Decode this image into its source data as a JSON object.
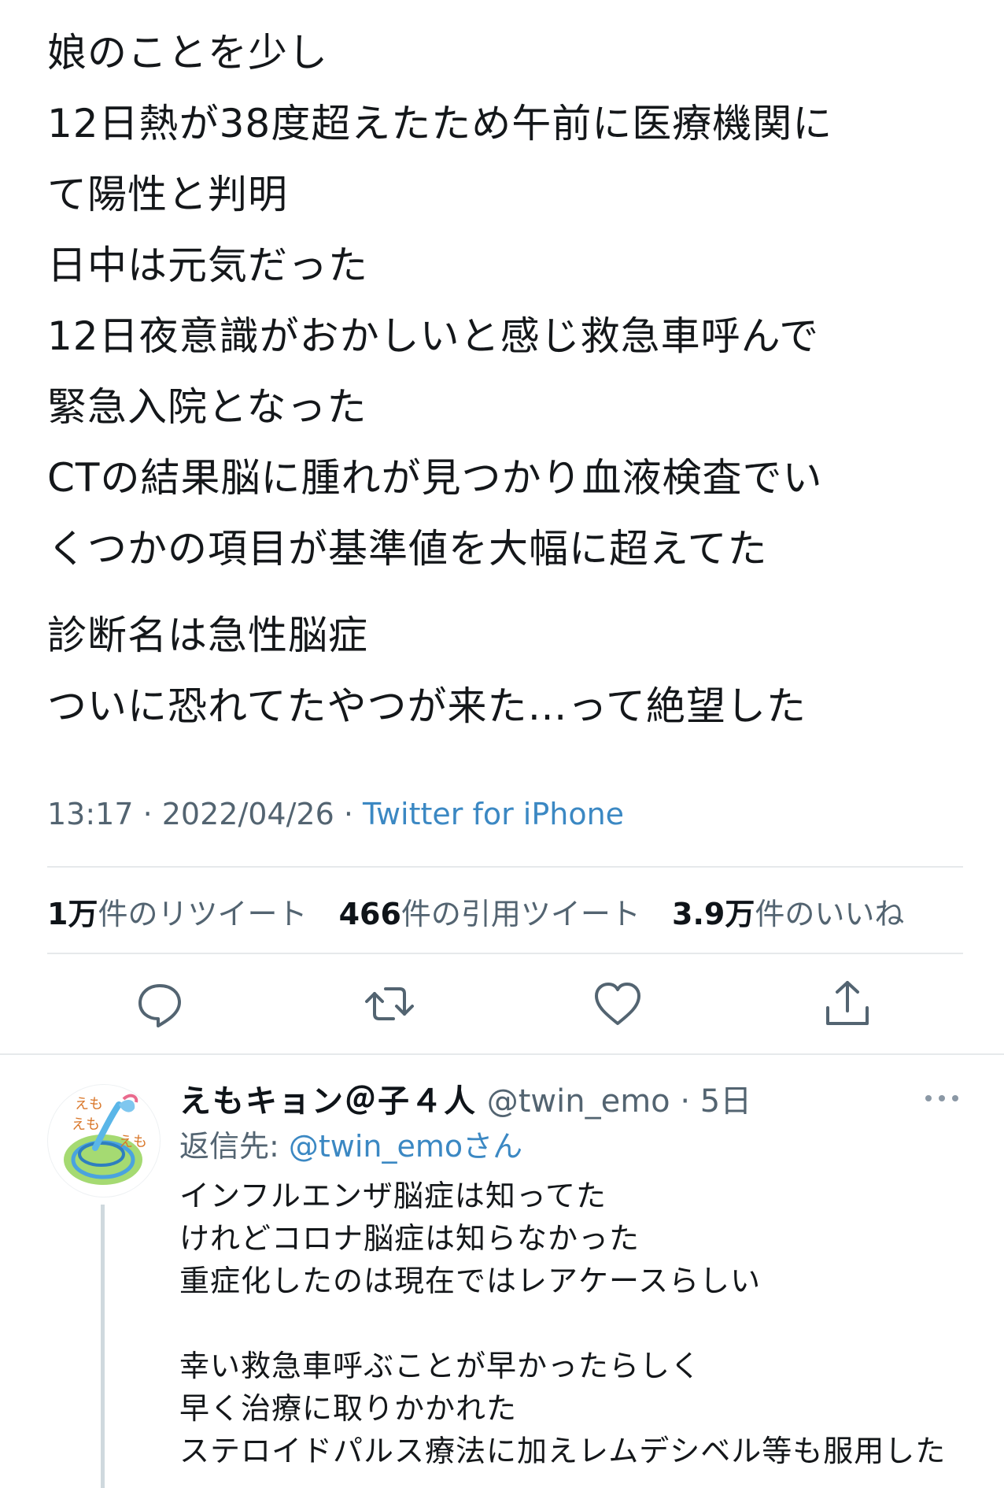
{
  "tweet": {
    "lines": [
      "娘のことを少し",
      "12日熱が38度超えたため午前に医療機関に",
      "て陽性と判明",
      "日中は元気だった",
      "12日夜意識がおかしいと感じ救急車呼んで",
      "緊急入院となった",
      "CTの結果脳に腫れが見つかり血液検査でい",
      "くつかの項目が基準値を大幅に超えてた"
    ],
    "lines2": [
      "診断名は急性脳症",
      "ついに恐れてたやつが来た…って絶望した"
    ],
    "time": "13:17 · 2022/04/26 · ",
    "source": "Twitter for iPhone"
  },
  "stats": {
    "retweets_num": "1万",
    "retweets_label": "件のリツイート",
    "quotes_num": "466",
    "quotes_label": "件の引用ツイート",
    "likes_num": "3.9万",
    "likes_label": "件のいいね"
  },
  "actions": {
    "reply_icon": "reply-icon",
    "retweet_icon": "retweet-icon",
    "like_icon": "heart-icon",
    "share_icon": "share-icon"
  },
  "reply": {
    "name": "えもキョン＠子４人",
    "handle": "@twin_emo",
    "time": "· 5日",
    "reply_to_label": "返信先: ",
    "reply_to_handle": "@twin_emo",
    "reply_to_suffix": "さん",
    "body": [
      "インフルエンザ脳症は知ってた",
      "けれどコロナ脳症は知らなかった",
      "重症化したのは現在ではレアケースらしい",
      "",
      "幸い救急車呼ぶことが早かったらしく",
      "早く治療に取りかかれた",
      "ステロイドパルス療法に加えレムデシベル等も服用した"
    ]
  },
  "colors": {
    "link": "#3b88c3",
    "muted": "#536471",
    "text": "#14171a"
  }
}
